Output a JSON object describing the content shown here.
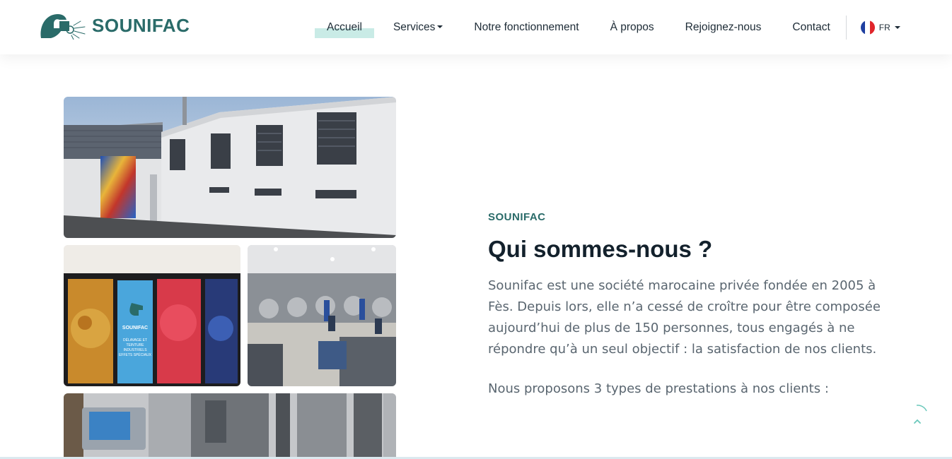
{
  "brand": {
    "name": "SOUNIFAC",
    "color": "#2a6b69"
  },
  "nav": {
    "items": [
      {
        "label": "Accueil",
        "active": true
      },
      {
        "label": "Services",
        "dropdown": true
      },
      {
        "label": "Notre fonctionnement"
      },
      {
        "label": "À propos"
      },
      {
        "label": "Rejoignez-nous"
      },
      {
        "label": "Contact"
      }
    ],
    "language": {
      "code": "FR",
      "icon": "france-flag-icon"
    }
  },
  "images": {
    "shop_sign_brand": "SOUNIFAC",
    "shop_sign_tagline": "DÉLAVAGE ET TEINTURE INDUSTRIELS EFFETS SPÉCIAUX"
  },
  "about": {
    "eyebrow": "SOUNIFAC",
    "title": "Qui sommes-nous ?",
    "paragraph": "Sounifac est une société marocaine privée fondée en 2005 à Fès. Depuis lors, elle n’a cessé de croître pour être composée aujourd’hui de plus de 150 personnes, tous engagés à ne répondre qu’à un seul objectif : la satisfaction de nos clients.",
    "services_intro": "Nous proposons 3 types de prestations à nos clients :"
  },
  "colors": {
    "accent": "#2a6b69",
    "active_highlight": "#c9ebe6",
    "body_text": "#5a6670"
  }
}
